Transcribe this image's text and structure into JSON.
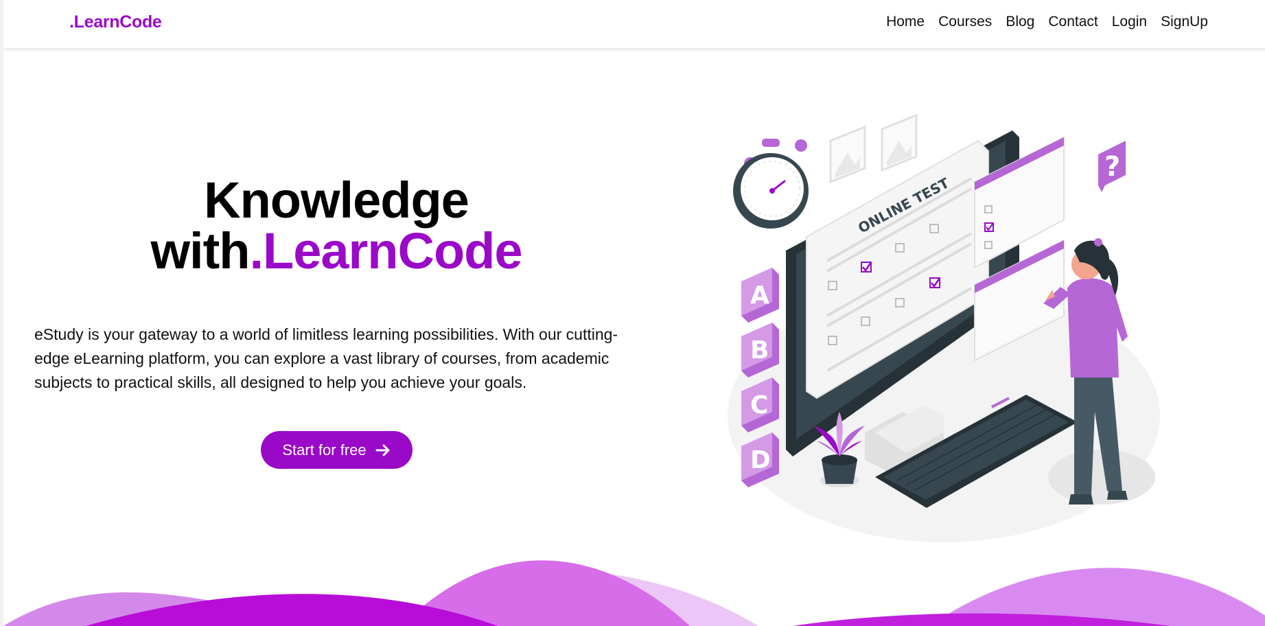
{
  "navbar": {
    "brand": ".LearnCode",
    "links": [
      "Home",
      "Courses",
      "Blog",
      "Contact",
      "Login",
      "SignUp"
    ]
  },
  "hero": {
    "title_line1": "Knowledge",
    "title_prefix": "with",
    "title_accent": ".LearnCode",
    "description": "eStudy is your gateway to a world of limitless learning possibilities. With our cutting-edge eLearning platform, you can explore a vast library of courses, from academic subjects to practical skills, all designed to help you achieve your goals.",
    "cta_label": "Start for free"
  },
  "illustration": {
    "screen_title": "ONLINE TEST",
    "choices": [
      "A",
      "B",
      "C",
      "D"
    ],
    "question_mark": "?"
  },
  "colors": {
    "accent": "#9a08c8",
    "accent_light": "#b567d6",
    "dark": "#263238"
  }
}
